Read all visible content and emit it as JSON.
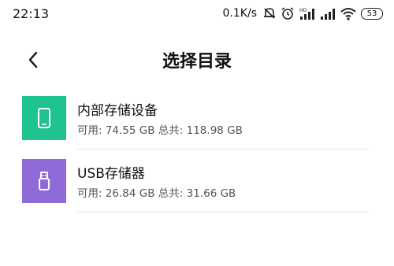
{
  "status_bar": {
    "time": "22:13",
    "net_speed": "0.1K/s",
    "battery": "53"
  },
  "header": {
    "title": "选择目录",
    "back_icon": "chevron-left-icon"
  },
  "storage": [
    {
      "name": "内部存储设备",
      "detail": "可用: 74.55 GB 总共: 118.98 GB",
      "icon": "phone-icon",
      "color": "#1ec38f"
    },
    {
      "name": "USB存储器",
      "detail": "可用: 26.84 GB 总共: 31.66 GB",
      "icon": "usb-drive-icon",
      "color": "#8e6bd6"
    }
  ]
}
